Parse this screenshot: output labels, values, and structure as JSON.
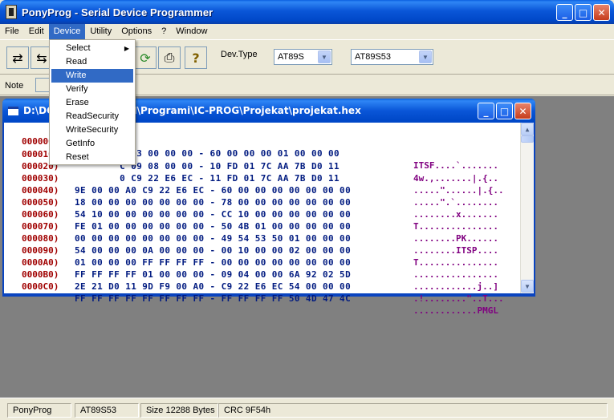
{
  "window": {
    "title": "PonyProg - Serial Device Programmer",
    "minimize_glyph": "_",
    "maximize_glyph": "□",
    "close_glyph": "✕"
  },
  "menubar": [
    "File",
    "Edit",
    "Device",
    "Utility",
    "Options",
    "?",
    "Window"
  ],
  "device_menu": {
    "items": [
      "Select",
      "Read",
      "Write",
      "Verify",
      "Erase",
      "ReadSecurity",
      "WriteSecurity",
      "GetInfo",
      "Reset"
    ],
    "highlighted": "Write",
    "submenu_arrow": "▶"
  },
  "toolbar": {
    "icons": [
      "open-file-icon",
      "save-file-icon",
      "reload-icon",
      "print-icon",
      "help-icon"
    ],
    "icon_glyphs": [
      "⇄",
      "⇆",
      "⟳",
      "⎙",
      "?"
    ],
    "devtype_label": "Dev.Type",
    "family_select": "AT89S",
    "device_select": "AT89S53",
    "dropdown_arrow": "▼"
  },
  "note": {
    "label": "Note"
  },
  "child_window": {
    "title": "D:\\DO… KONTROLERI\\Programi\\IC-PROG\\Projekat\\projekat.hex",
    "rows": [
      {
        "addr": "000000)",
        "bytes": "        6 03 00 00 00 - 60 00 00 00 01 00 00 00",
        "ascii": "ITSF....`......."
      },
      {
        "addr": "000010)",
        "bytes": "        C 09 08 00 00 - 10 FD 01 7C AA 7B D0 11",
        "ascii": "4w.,.......|.{.."
      },
      {
        "addr": "000020)",
        "bytes": "        0 C9 22 E6 EC - 11 FD 01 7C AA 7B D0 11",
        "ascii": ".....\"......|.{.."
      },
      {
        "addr": "000030)",
        "bytes": "9E 00 00 A0 C9 22 E6 EC - 60 00 00 00 00 00 00 00",
        "ascii": ".....\".`........"
      },
      {
        "addr": "000040)",
        "bytes": "18 00 00 00 00 00 00 00 - 78 00 00 00 00 00 00 00",
        "ascii": "........x......."
      },
      {
        "addr": "000050)",
        "bytes": "54 10 00 00 00 00 00 00 - CC 10 00 00 00 00 00 00",
        "ascii": "T..............."
      },
      {
        "addr": "000060)",
        "bytes": "FE 01 00 00 00 00 00 00 - 50 4B 01 00 00 00 00 00",
        "ascii": "........PK......"
      },
      {
        "addr": "000070)",
        "bytes": "00 00 00 00 00 00 00 00 - 49 54 53 50 01 00 00 00",
        "ascii": "........ITSP...."
      },
      {
        "addr": "000080)",
        "bytes": "54 00 00 00 0A 00 00 00 - 00 10 00 00 02 00 00 00",
        "ascii": "T..............."
      },
      {
        "addr": "000090)",
        "bytes": "01 00 00 00 FF FF FF FF - 00 00 00 00 00 00 00 00",
        "ascii": "................"
      },
      {
        "addr": "0000A0)",
        "bytes": "FF FF FF FF 01 00 00 00 - 09 04 00 00 6A 92 02 5D",
        "ascii": "............j..]"
      },
      {
        "addr": "0000B0)",
        "bytes": "2E 21 D0 11 9D F9 00 A0 - C9 22 E6 EC 54 00 00 00",
        "ascii": ".!........\"..T..."
      },
      {
        "addr": "0000C0)",
        "bytes": "FF FF FF FF FF FF FF FF - FF FF FF FF 50 4D 47 4C",
        "ascii": "............PMGL"
      }
    ],
    "scroll_up": "▲",
    "scroll_down": "▼"
  },
  "statusbar": {
    "app": "PonyProg",
    "device": "AT89S53",
    "size": "Size 12288 Bytes",
    "crc": "CRC  9F54h"
  }
}
